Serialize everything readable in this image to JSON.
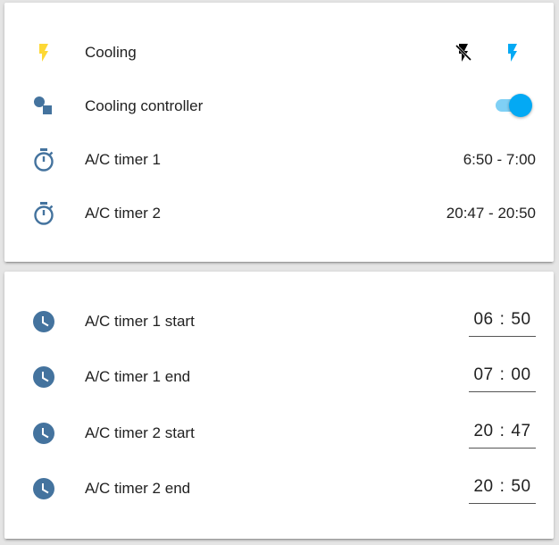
{
  "entities_card": {
    "rows": [
      {
        "label": "Cooling",
        "type": "buttons",
        "icon": "lightning-bolt-icon"
      },
      {
        "label": "Cooling controller",
        "type": "toggle",
        "state": "on",
        "icon": "shapes-icon"
      },
      {
        "label": "A/C timer 1",
        "type": "text",
        "value": "6:50 - 7:00",
        "icon": "timer-icon"
      },
      {
        "label": "A/C timer 2",
        "type": "text",
        "value": "20:47 - 20:50",
        "icon": "timer-icon"
      }
    ]
  },
  "time_card": {
    "rows": [
      {
        "label": "A/C timer 1 start",
        "hours": "06",
        "minutes": "50",
        "icon": "clock-icon"
      },
      {
        "label": "A/C timer 1 end",
        "hours": "07",
        "minutes": "00",
        "icon": "clock-icon"
      },
      {
        "label": "A/C timer 2 start",
        "hours": "20",
        "minutes": "47",
        "icon": "clock-icon"
      },
      {
        "label": "A/C timer 2 end",
        "hours": "20",
        "minutes": "50",
        "icon": "clock-icon"
      }
    ],
    "separator": ":"
  },
  "colors": {
    "active_yellow": "#fdd835",
    "accent_blue": "#03a9f4",
    "icon_blue": "#44739e",
    "text": "#212121"
  }
}
